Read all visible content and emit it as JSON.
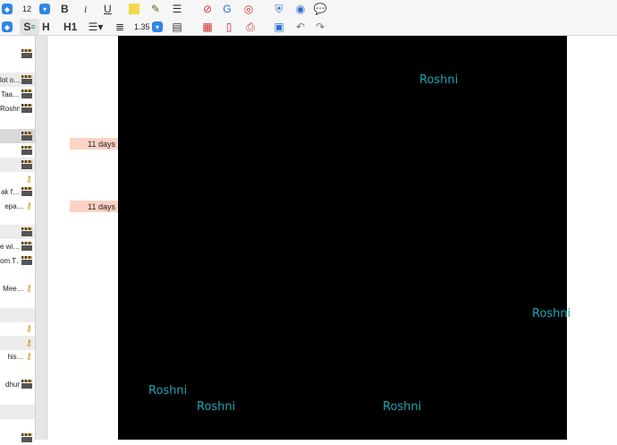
{
  "toolbar": {
    "font_size": "12",
    "bold_label": "B",
    "italic_label": "i",
    "underline_label": "U",
    "h_label": "H",
    "h1_label": "H1",
    "line_spacing": "1.35"
  },
  "list": {
    "rows": [
      {
        "text": "",
        "icon": "clapper"
      },
      {
        "text": "lot o…",
        "icon": "clapper"
      },
      {
        "text": "Taa…",
        "icon": "clapper"
      },
      {
        "text": "Roshni",
        "icon": "clapper"
      },
      {
        "text": "",
        "icon": "clapper"
      },
      {
        "text": "",
        "icon": "clapper"
      },
      {
        "text": "",
        "icon": "clapper"
      },
      {
        "text": "",
        "icon": "key"
      },
      {
        "text": "ak f…",
        "icon": "clapper"
      },
      {
        "text": "epa…",
        "icon": "key"
      },
      {
        "text": "",
        "icon": "clapper"
      },
      {
        "text": "e wi…",
        "icon": "clapper"
      },
      {
        "text": "om T…",
        "icon": "clapper"
      },
      {
        "text": "Mee…",
        "icon": "key"
      },
      {
        "text": "",
        "icon": "key"
      },
      {
        "text": "",
        "icon": "key"
      },
      {
        "text": "his…",
        "icon": "key"
      },
      {
        "text": "dhur",
        "icon": "clapper"
      },
      {
        "text": "",
        "icon": "clapper"
      }
    ]
  },
  "badges": [
    "11 days",
    "11 days"
  ],
  "video": {
    "captions": [
      "Roshni",
      "Roshni",
      "Roshni",
      "Roshni",
      "Roshni"
    ]
  }
}
